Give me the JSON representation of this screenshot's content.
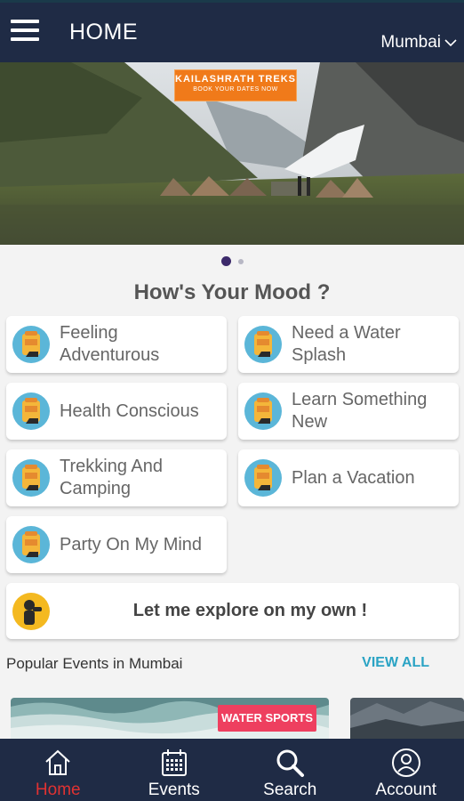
{
  "header": {
    "title": "HOME",
    "city": "Mumbai"
  },
  "banner": {
    "logo_title": "KAILASHRATH TREKS",
    "logo_subtitle": "BOOK YOUR DATES NOW",
    "slide_count": 2,
    "active_slide": 1
  },
  "mood": {
    "title": "How's Your Mood ?",
    "items": [
      {
        "label_line1": "Feeling",
        "label_line2": "Adventurous"
      },
      {
        "label_line1": "Need a Water",
        "label_line2": "Splash"
      },
      {
        "label_line1": "Health Conscious",
        "label_line2": ""
      },
      {
        "label_line1": "Learn Something",
        "label_line2": "New"
      },
      {
        "label_line1": "Trekking And",
        "label_line2": "Camping"
      },
      {
        "label_line1": "Plan a Vacation",
        "label_line2": ""
      },
      {
        "label_line1": "Party On My Mind",
        "label_line2": ""
      }
    ],
    "explore_label": "Let me explore on my own !"
  },
  "popular": {
    "title": "Popular Events in Mumbai",
    "view_all": "VIEW ALL",
    "events": [
      {
        "tag": "WATER SPORTS"
      }
    ]
  },
  "nav": {
    "items": [
      {
        "label": "Home",
        "icon": "home-icon"
      },
      {
        "label": "Events",
        "icon": "calendar-icon"
      },
      {
        "label": "Search",
        "icon": "search-icon"
      },
      {
        "label": "Account",
        "icon": "account-icon"
      }
    ],
    "active": "Home"
  },
  "colors": {
    "appbar": "#1f2b45",
    "accent_link": "#2aa3c4",
    "active_nav": "#e03232",
    "event_tag": "#ee3f5f"
  }
}
